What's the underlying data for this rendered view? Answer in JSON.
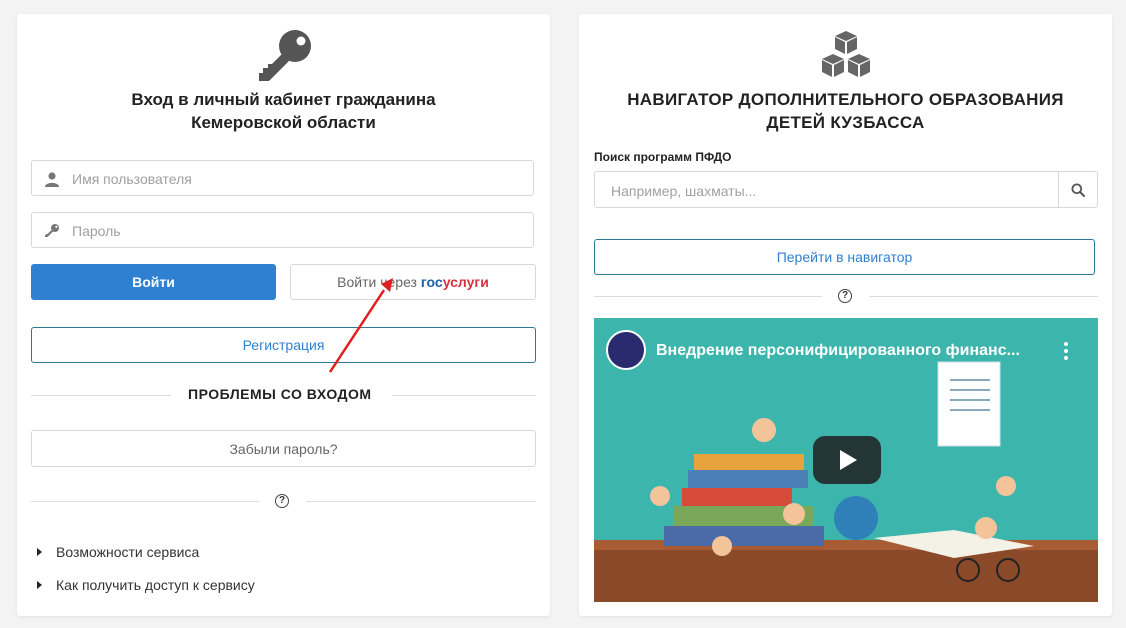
{
  "login": {
    "title_line1": "Вход в личный кабинет гражданина",
    "title_line2": "Кемеровской области",
    "username_placeholder": "Имя пользователя",
    "password_placeholder": "Пароль",
    "login_button": "Войти",
    "gosuslugi_prefix": "Войти через ",
    "gosuslugi_gos": "гос",
    "gosuslugi_uslugi": "услуги",
    "register_button": "Регистрация",
    "problems_heading": "ПРОБЛЕМЫ СО ВХОДОМ",
    "forgot_button": "Забыли пароль?",
    "help_symbol": "?",
    "links": [
      {
        "label": "Возможности сервиса"
      },
      {
        "label": "Как получить доступ к сервису"
      }
    ]
  },
  "navigator": {
    "title_line1": "НАВИГАТОР ДОПОЛНИТЕЛЬНОГО ОБРАЗОВАНИЯ",
    "title_line2": "ДЕТЕЙ КУЗБАССА",
    "search_label": "Поиск программ ПФДО",
    "search_placeholder": "Например, шахматы...",
    "go_button": "Перейти в навигатор",
    "help_symbol": "?",
    "video": {
      "title": "Внедрение персонифицированного финанс..."
    }
  },
  "colors": {
    "primary": "#2f80d1",
    "gos_blue": "#1b5fa8",
    "gos_red": "#d9303a",
    "arrow": "#e02020",
    "video_bg": "#3cb5ad"
  }
}
